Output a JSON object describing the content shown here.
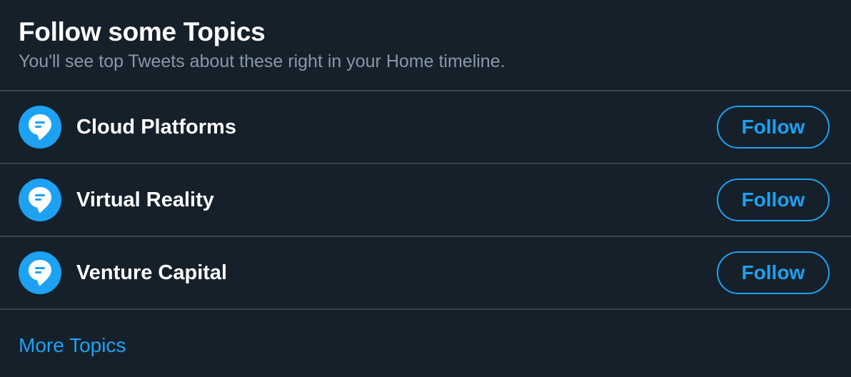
{
  "header": {
    "title": "Follow some Topics",
    "subtitle": "You'll see top Tweets about these right in your Home timeline."
  },
  "topics": [
    {
      "name": "Cloud Platforms",
      "follow_label": "Follow",
      "icon": "topic-bubble-icon"
    },
    {
      "name": "Virtual Reality",
      "follow_label": "Follow",
      "icon": "topic-bubble-icon"
    },
    {
      "name": "Venture Capital",
      "follow_label": "Follow",
      "icon": "topic-bubble-icon"
    }
  ],
  "footer": {
    "more_topics_label": "More Topics"
  },
  "colors": {
    "background": "#15202b",
    "accent": "#1da1f2",
    "divider": "#38444d",
    "primary_text": "#ffffff",
    "secondary_text": "#8899a6"
  }
}
